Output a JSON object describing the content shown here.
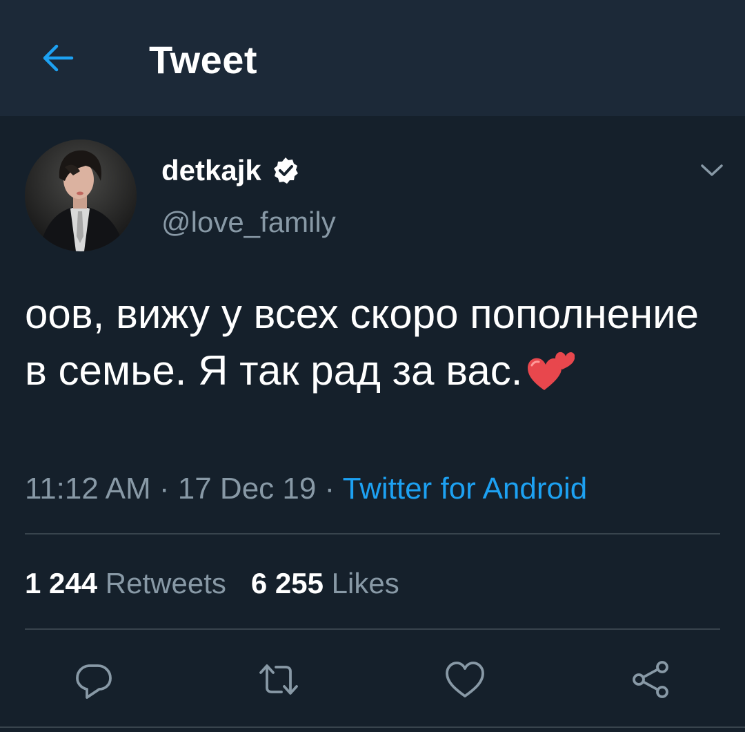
{
  "header": {
    "title": "Tweet",
    "back_icon": "back-arrow-icon",
    "accent_color": "#1da1f2"
  },
  "user": {
    "display_name": "detkajk",
    "verified": true,
    "handle": "@love_family"
  },
  "tweet": {
    "text": "оов, вижу у всех скоро пополнение в семье. Я так рад за вас.",
    "emoji": "two-hearts-emoji",
    "time": "11:12 AM",
    "date": "17 Dec 19",
    "separator": " · ",
    "source": "Twitter for Android"
  },
  "stats": {
    "retweets_count": "1 244",
    "retweets_label": "Retweets",
    "likes_count": "6 255",
    "likes_label": "Likes"
  },
  "actions": [
    {
      "name": "reply",
      "icon": "reply-icon"
    },
    {
      "name": "retweet",
      "icon": "retweet-icon"
    },
    {
      "name": "like",
      "icon": "heart-icon"
    },
    {
      "name": "share",
      "icon": "share-icon"
    }
  ],
  "colors": {
    "background": "#15202b",
    "header_background": "#1c2938",
    "secondary_text": "#8899a6",
    "link": "#1da1f2",
    "divider": "#38444d"
  }
}
